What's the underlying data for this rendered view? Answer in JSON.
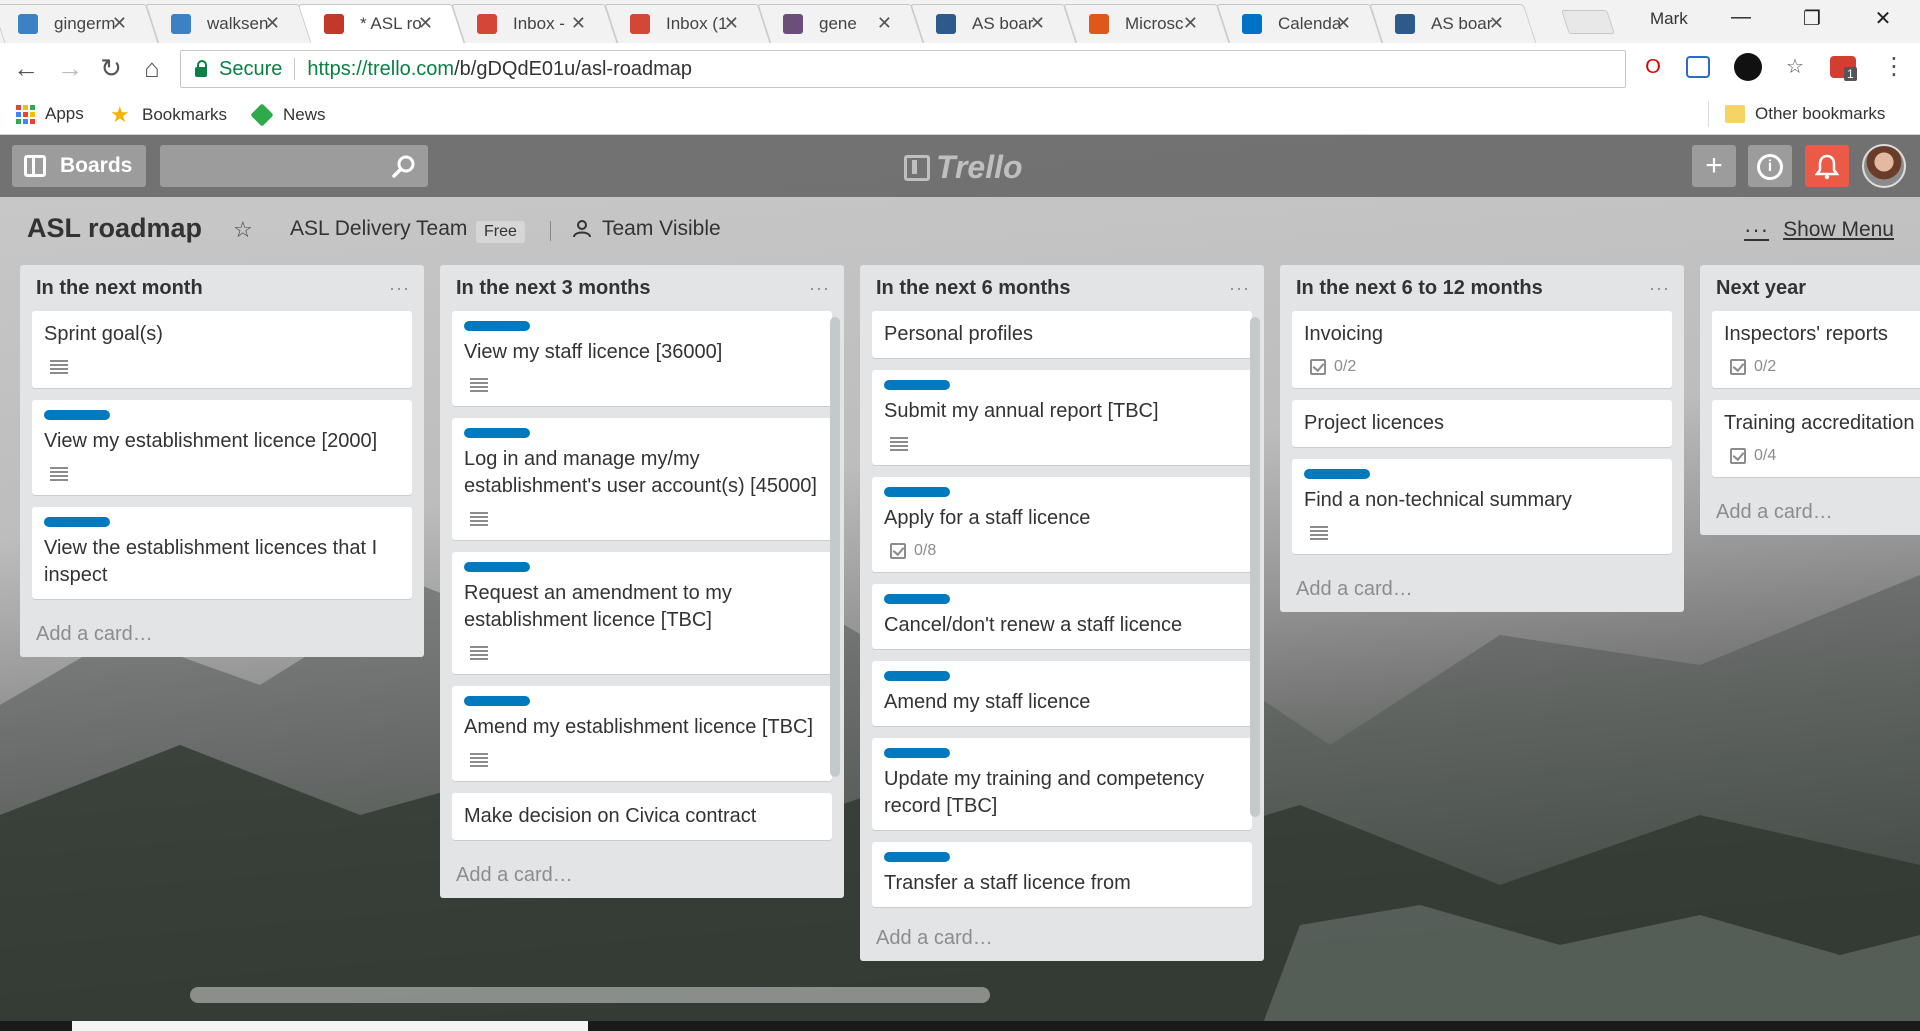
{
  "browser": {
    "tabs": [
      {
        "title": "gingerm",
        "favicon": "cloud-icon",
        "color": "#3b82c4",
        "active": false
      },
      {
        "title": "walksen",
        "favicon": "cloud-icon",
        "color": "#3b82c4",
        "active": false
      },
      {
        "title": "* ASL ro",
        "favicon": "trello-icon",
        "color": "#c0392b",
        "active": true
      },
      {
        "title": "Inbox -",
        "favicon": "gmail-icon",
        "color": "#d44638",
        "active": false
      },
      {
        "title": "Inbox (1",
        "favicon": "gmail-icon",
        "color": "#d44638",
        "active": false
      },
      {
        "title": "gene",
        "favicon": "slack-icon",
        "color": "#6b4f7a",
        "active": false
      },
      {
        "title": "AS boar",
        "favicon": "jira-icon",
        "color": "#2d5a8a",
        "active": false
      },
      {
        "title": "Microsc",
        "favicon": "office-icon",
        "color": "#e0571c",
        "active": false
      },
      {
        "title": "Calenda",
        "favicon": "outlook-icon",
        "color": "#0072c6",
        "active": false
      },
      {
        "title": "AS boar",
        "favicon": "jira-icon",
        "color": "#2d5a8a",
        "active": false
      }
    ],
    "close_glyph": "✕",
    "profile_name": "Mark",
    "window_controls": {
      "minimize": "—",
      "restore": "❐",
      "close": "✕"
    },
    "address": {
      "secure_label": "Secure",
      "url_host": "https://trello.com",
      "url_path": "/b/gDQdE01u/asl-roadmap"
    },
    "bookmarks": {
      "apps": "Apps",
      "bookmarks": "Bookmarks",
      "news": "News",
      "other": "Other bookmarks"
    },
    "extension_badge": "1"
  },
  "trello": {
    "boards_label": "Boards",
    "logo_text": "Trello",
    "board_title": "ASL roadmap",
    "team_name": "ASL Delivery Team",
    "team_plan": "Free",
    "visibility": "Team Visible",
    "show_menu": "Show Menu",
    "header_buttons": {
      "add": "+",
      "info": "i",
      "notifications": "bell"
    },
    "lists": [
      {
        "title": "In the next month",
        "add_card": "Add a card…",
        "cards": [
          {
            "title": "Sprint goal(s)",
            "label": false,
            "description": true
          },
          {
            "title": "View my establishment licence [2000]",
            "label": true,
            "description": true
          },
          {
            "title": "View the establishment licences that I inspect",
            "label": true,
            "description": false
          }
        ]
      },
      {
        "title": "In the next 3 months",
        "add_card": "Add a card…",
        "cards": [
          {
            "title": "View my staff licence [36000]",
            "label": true,
            "description": true
          },
          {
            "title": "Log in and manage my/my establishment's user account(s) [45000]",
            "label": true,
            "description": true
          },
          {
            "title": "Request an amendment to my establishment licence [TBC]",
            "label": true,
            "description": true
          },
          {
            "title": "Amend my establishment licence [TBC]",
            "label": true,
            "description": true
          },
          {
            "title": "Make decision on Civica contract",
            "label": false,
            "description": false
          }
        ]
      },
      {
        "title": "In the next 6 months",
        "add_card": "Add a card…",
        "cards": [
          {
            "title": "Personal profiles",
            "label": false,
            "description": false
          },
          {
            "title": "Submit my annual report [TBC]",
            "label": true,
            "description": true
          },
          {
            "title": "Apply for a staff licence",
            "label": true,
            "checklist": "0/8"
          },
          {
            "title": "Cancel/don't renew a staff licence",
            "label": true,
            "description": false
          },
          {
            "title": "Amend my staff licence",
            "label": true,
            "description": false
          },
          {
            "title": "Update my training and competency record [TBC]",
            "label": true,
            "description": false
          },
          {
            "title": "Transfer a staff licence from",
            "label": true,
            "description": false
          }
        ]
      },
      {
        "title": "In the next 6 to 12 months",
        "add_card": "Add a card…",
        "cards": [
          {
            "title": "Invoicing",
            "label": false,
            "checklist": "0/2"
          },
          {
            "title": "Project licences",
            "label": false,
            "description": false
          },
          {
            "title": "Find a non-technical summary",
            "label": true,
            "description": true
          }
        ]
      },
      {
        "title": "Next year",
        "add_card": "Add a card…",
        "cards": [
          {
            "title": "Inspectors' reports",
            "label": false,
            "checklist": "0/2"
          },
          {
            "title": "Training accreditation",
            "label": false,
            "checklist": "0/4"
          }
        ]
      }
    ]
  },
  "colors": {
    "label_blue": "#0079bf",
    "notification_red": "#eb5a46",
    "secure_green": "#0b8043"
  }
}
